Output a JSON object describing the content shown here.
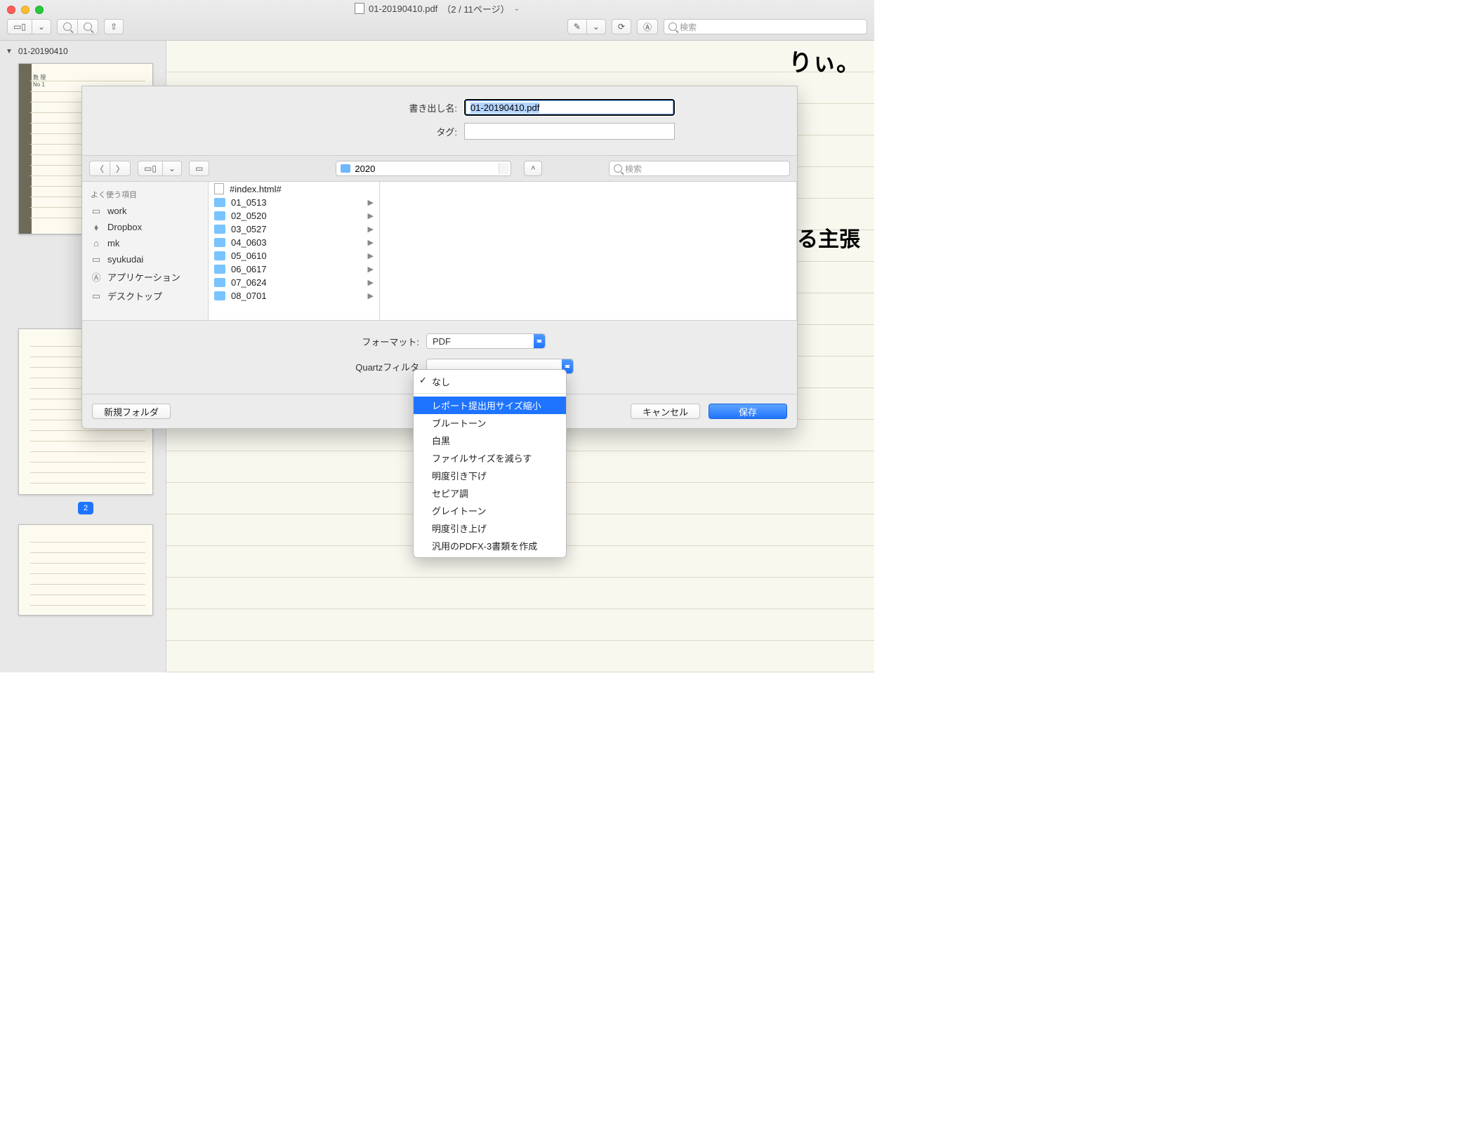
{
  "title": {
    "doc": "01-20190410.pdf",
    "pages": "（2 / 11ページ）"
  },
  "toolbar": {
    "search_placeholder": "検索"
  },
  "thumbs": {
    "filename": "01-20190410",
    "current_page_badge": "2"
  },
  "doc": {
    "hand1": "りぃ。",
    "hand2": "る主張"
  },
  "sheet": {
    "name_label": "書き出し名:",
    "name_value": "01-20190410.pdf",
    "tag_label": "タグ:",
    "location": "2020",
    "search_placeholder": "検索",
    "sidebar_header": "よく使う項目",
    "sidebar_items": [
      {
        "icon": "folder",
        "label": "work"
      },
      {
        "icon": "dropbox",
        "label": "Dropbox"
      },
      {
        "icon": "home",
        "label": "mk"
      },
      {
        "icon": "folder",
        "label": "syukudai"
      },
      {
        "icon": "app",
        "label": "アプリケーション"
      },
      {
        "icon": "folder",
        "label": "デスクトップ"
      }
    ],
    "col_items": [
      {
        "type": "file",
        "label": "#index.html#"
      },
      {
        "type": "folder",
        "label": "01_0513"
      },
      {
        "type": "folder",
        "label": "02_0520"
      },
      {
        "type": "folder",
        "label": "03_0527"
      },
      {
        "type": "folder",
        "label": "04_0603"
      },
      {
        "type": "folder",
        "label": "05_0610"
      },
      {
        "type": "folder",
        "label": "06_0617"
      },
      {
        "type": "folder",
        "label": "07_0624"
      },
      {
        "type": "folder",
        "label": "08_0701"
      }
    ],
    "format_label": "フォーマット:",
    "format_value": "PDF",
    "quartz_label": "Quartzフィルタ",
    "quartz_menu": {
      "current": "なし",
      "highlighted": "レポート提出用サイズ縮小",
      "items": [
        "ブルートーン",
        "白黒",
        "ファイルサイズを減らす",
        "明度引き下げ",
        "セピア調",
        "グレイトーン",
        "明度引き上げ",
        "汎用のPDFX-3書類を作成"
      ]
    },
    "new_folder": "新規フォルダ",
    "cancel": "キャンセル",
    "save": "保存"
  }
}
